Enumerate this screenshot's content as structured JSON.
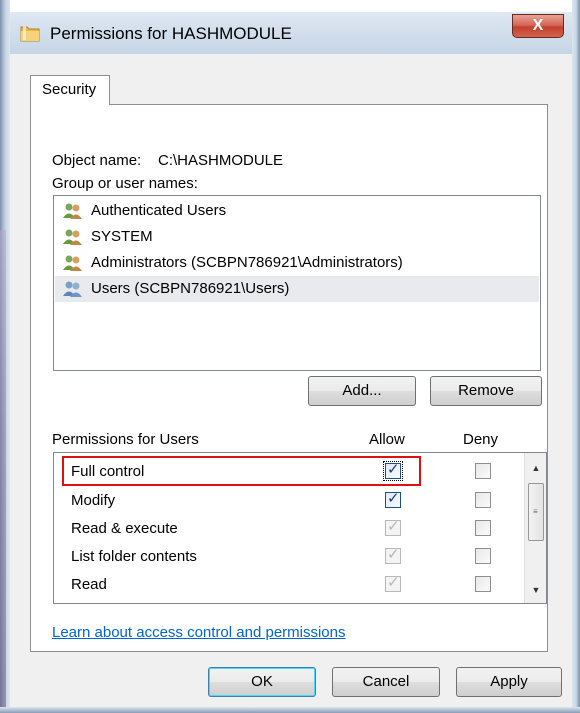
{
  "window": {
    "title": "Permissions for HASHMODULE",
    "close_glyph": "X",
    "icon": "folder-icon"
  },
  "tabs": [
    {
      "label": "Security"
    }
  ],
  "object_name": {
    "label": "Object name:",
    "value": "C:\\HASHMODULE"
  },
  "group_names": {
    "label": "Group or user names:",
    "items": [
      {
        "name": "Authenticated Users",
        "selected": false
      },
      {
        "name": "SYSTEM",
        "selected": false
      },
      {
        "name": "Administrators (SCBPN786921\\Administrators)",
        "selected": false
      },
      {
        "name": "Users (SCBPN786921\\Users)",
        "selected": true
      }
    ],
    "icon": "user-group-icon"
  },
  "buttons": {
    "add": "Add...",
    "remove": "Remove",
    "ok": "OK",
    "cancel": "Cancel",
    "apply": "Apply"
  },
  "permissions": {
    "header": "Permissions for Users",
    "allow_label": "Allow",
    "deny_label": "Deny",
    "rows": [
      {
        "name": "Full control",
        "allow": "checked",
        "deny": "unchecked"
      },
      {
        "name": "Modify",
        "allow": "checked",
        "deny": "unchecked"
      },
      {
        "name": "Read & execute",
        "allow": "inherited",
        "deny": "unchecked"
      },
      {
        "name": "List folder contents",
        "allow": "inherited",
        "deny": "unchecked"
      },
      {
        "name": "Read",
        "allow": "inherited",
        "deny": "unchecked"
      }
    ]
  },
  "link": {
    "text": "Learn about access control and permissions"
  },
  "colors": {
    "highlight": "#e01010",
    "link": "#0066cc",
    "selection": "#e8eaee"
  }
}
